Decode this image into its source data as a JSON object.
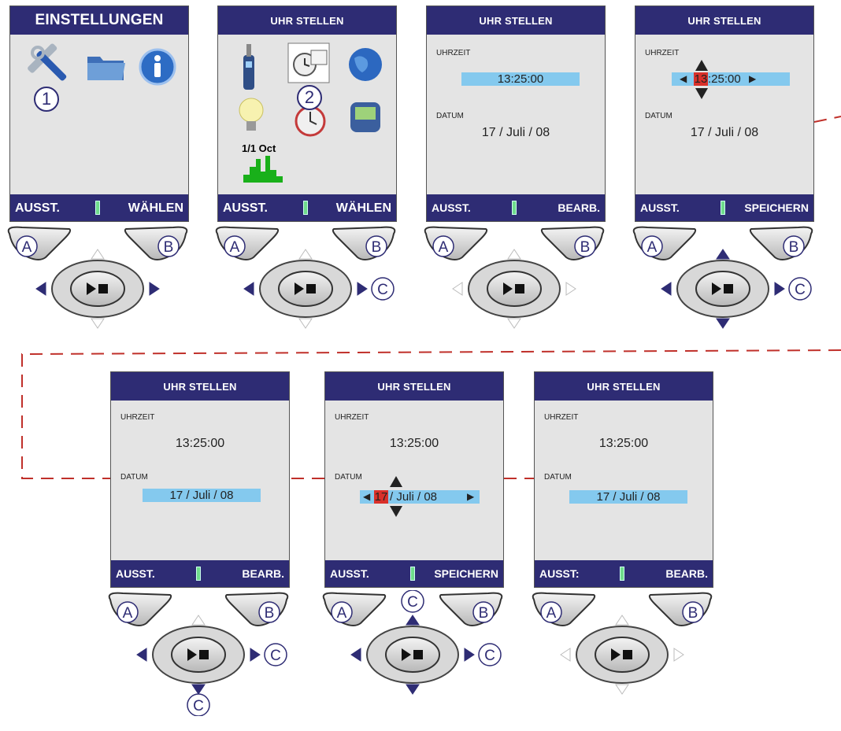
{
  "screens": [
    {
      "title": "EINSTELLUNGEN",
      "foot_left": "AUSST.",
      "foot_right": "WÄHLEN"
    },
    {
      "title": "UHR STELLEN",
      "foot_left": "AUSST.",
      "foot_right": "WÄHLEN",
      "oct_label": "1/1 Oct"
    },
    {
      "title": "UHR STELLEN",
      "foot_left": "AUSST.",
      "foot_right": "BEARB.",
      "time_label": "UHRZEIT",
      "time": "13:25:00",
      "date_label": "DATUM",
      "date": "17 / Juli / 08"
    },
    {
      "title": "UHR STELLEN",
      "foot_left": "AUSST.",
      "foot_right": "SPEICHERN",
      "time_label": "UHRZEIT",
      "time_sel": "13",
      "time_rest": ":25:00",
      "date_label": "DATUM",
      "date": "17 / Juli / 08"
    },
    {
      "title": "UHR STELLEN",
      "foot_left": "AUSST.",
      "foot_right": "BEARB.",
      "time_label": "UHRZEIT",
      "time": "13:25:00",
      "date_label": "DATUM",
      "date": "17 / Juli / 08"
    },
    {
      "title": "UHR STELLEN",
      "foot_left": "AUSST.",
      "foot_right": "SPEICHERN",
      "time_label": "UHRZEIT",
      "time": "13:25:00",
      "date_label": "DATUM",
      "date_sel": "17",
      "date_rest": "/ Juli / 08"
    },
    {
      "title": "UHR STELLEN",
      "foot_left": "AUSST:",
      "foot_right": "BEARB.",
      "time_label": "UHRZEIT",
      "time": "13:25:00",
      "date_label": "DATUM",
      "date": "17 / Juli / 08"
    }
  ],
  "buttons": {
    "a": "A",
    "b": "B",
    "c": "C"
  },
  "steps": {
    "one": "1",
    "two": "2"
  },
  "colors": {
    "navy": "#2e2c74",
    "highlight": "#84c9ee",
    "selection": "#d9302a",
    "dash": "#c0302a"
  }
}
